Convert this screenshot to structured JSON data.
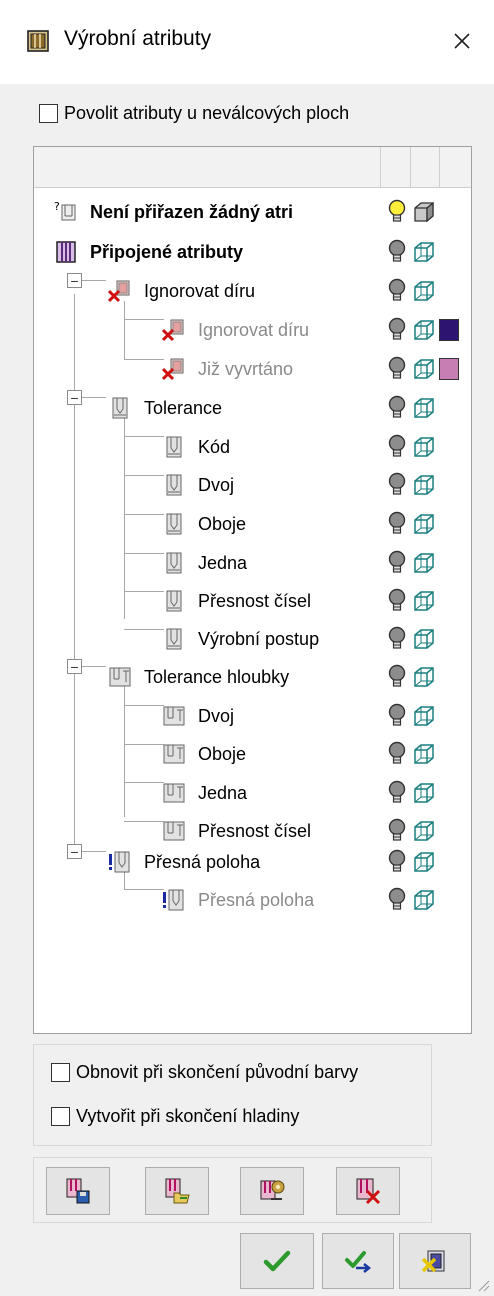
{
  "window": {
    "title": "Výrobní atributy",
    "close_label": "×"
  },
  "options": {
    "allow_non_cylindrical": "Povolit atributy u neválcových ploch",
    "restore_colors": "Obnovit při skončení původní barvy",
    "create_layers": "Vytvořit při skončení hladiny"
  },
  "tree": {
    "nodes": [
      {
        "label": "Není přiřazen žádný atri",
        "style": "bold",
        "bulb": "yellow-bulb",
        "cube": "solid-cube"
      },
      {
        "label": "Připojené atributy",
        "style": "bold",
        "bulb": "grey-bulb",
        "cube": "wire-cube"
      },
      {
        "label": "Ignorovat díru",
        "style": "normal",
        "bulb": "grey-bulb",
        "cube": "wire-cube"
      },
      {
        "label": "Ignorovat díru",
        "style": "grey",
        "bulb": "grey-bulb",
        "cube": "wire-cube",
        "swatch": "#2b1570"
      },
      {
        "label": "Již vyvrtáno",
        "style": "grey",
        "bulb": "grey-bulb",
        "cube": "wire-cube",
        "swatch": "#c77fb3"
      },
      {
        "label": "Tolerance",
        "style": "normal",
        "bulb": "grey-bulb",
        "cube": "wire-cube"
      },
      {
        "label": "Kód",
        "style": "normal",
        "bulb": "grey-bulb",
        "cube": "wire-cube"
      },
      {
        "label": "Dvoj",
        "style": "normal",
        "bulb": "grey-bulb",
        "cube": "wire-cube"
      },
      {
        "label": "Oboje",
        "style": "normal",
        "bulb": "grey-bulb",
        "cube": "wire-cube"
      },
      {
        "label": "Jedna",
        "style": "normal",
        "bulb": "grey-bulb",
        "cube": "wire-cube"
      },
      {
        "label": "Přesnost čísel",
        "style": "normal",
        "bulb": "grey-bulb",
        "cube": "wire-cube"
      },
      {
        "label": "Výrobní postup",
        "style": "normal",
        "bulb": "grey-bulb",
        "cube": "wire-cube"
      },
      {
        "label": "Tolerance hloubky",
        "style": "normal",
        "bulb": "grey-bulb",
        "cube": "wire-cube"
      },
      {
        "label": "Dvoj",
        "style": "normal",
        "bulb": "grey-bulb",
        "cube": "wire-cube"
      },
      {
        "label": "Oboje",
        "style": "normal",
        "bulb": "grey-bulb",
        "cube": "wire-cube"
      },
      {
        "label": "Jedna",
        "style": "normal",
        "bulb": "grey-bulb",
        "cube": "wire-cube"
      },
      {
        "label": "Přesnost čísel",
        "style": "normal",
        "bulb": "grey-bulb",
        "cube": "wire-cube"
      },
      {
        "label": "Přesná poloha",
        "style": "normal",
        "bulb": "grey-bulb",
        "cube": "wire-cube"
      },
      {
        "label": "Přesná poloha",
        "style": "grey",
        "bulb": "grey-bulb",
        "cube": "wire-cube"
      }
    ]
  },
  "toolbar": {
    "buttons": [
      "save-attributes-icon",
      "load-attributes-icon",
      "attribute-settings-icon",
      "delete-attributes-icon"
    ]
  },
  "actions": {
    "buttons": [
      "ok-check-icon",
      "apply-check-icon",
      "cancel-icon"
    ]
  },
  "colors": {
    "accent": "#1d6f2c",
    "swatch_purple": "#2b1570",
    "swatch_pink": "#c77fb3"
  }
}
